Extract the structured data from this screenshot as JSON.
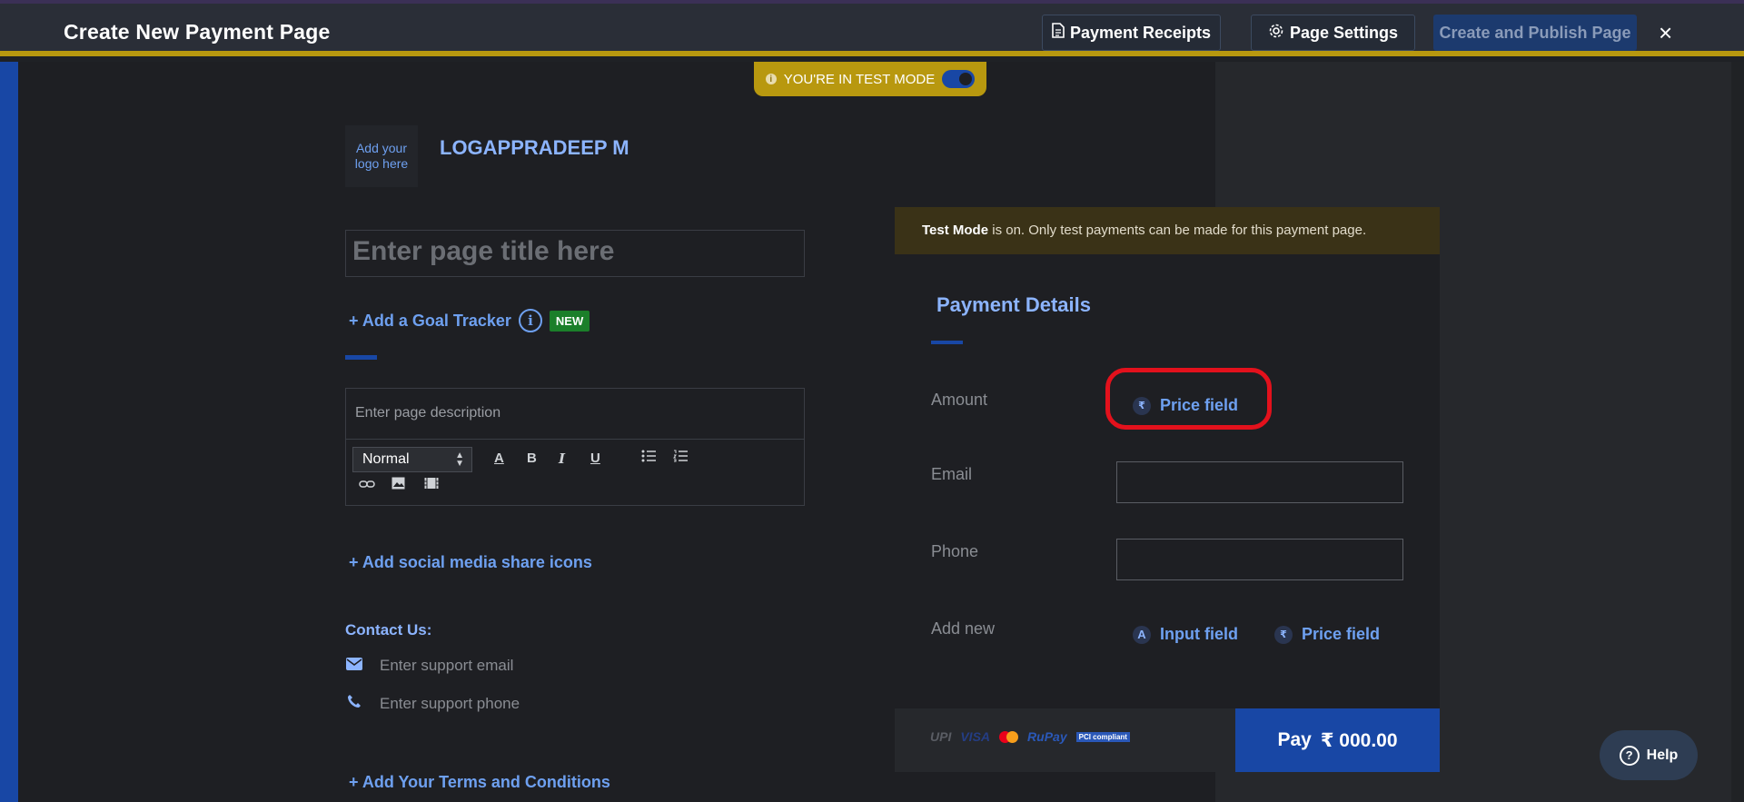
{
  "header": {
    "title": "Create New Payment Page",
    "receipts_label": "Payment Receipts",
    "settings_label": "Page Settings",
    "publish_label": "Create and Publish Page",
    "close_icon": "×"
  },
  "test_mode": {
    "label": "YOU'RE IN TEST MODE",
    "enabled": true
  },
  "page": {
    "logo_placeholder": "Add your logo here",
    "merchant_name": "LOGAPPRADEEP M",
    "title_placeholder": "Enter page title here",
    "goal_tracker_label": "+ Add a Goal Tracker",
    "new_badge": "NEW",
    "description_placeholder": "Enter page description",
    "editor_format": "Normal",
    "social_label": "+ Add social media share icons",
    "contact_heading": "Contact Us:",
    "support_email_placeholder": "Enter support email",
    "support_phone_placeholder": "Enter support phone",
    "terms_label": "+ Add Your Terms and Conditions"
  },
  "payment_card": {
    "banner_bold": "Test Mode",
    "banner_text": " is on. Only test payments can be made for this payment page.",
    "title": "Payment Details",
    "amount_label": "Amount",
    "price_field_label": "Price field",
    "email_label": "Email",
    "phone_label": "Phone",
    "add_new_label": "Add new",
    "add_input_label": "Input field",
    "add_price_label": "Price field",
    "pay_label": "Pay",
    "pay_amount": "₹ 000.00",
    "rupee_symbol": "₹",
    "logos": [
      "UPI",
      "VISA",
      "RuPay",
      "PCI compliant"
    ]
  },
  "help": {
    "label": "Help"
  },
  "colors": {
    "accent": "#1847a5",
    "gold": "#b8980f",
    "link": "#6ea0f0",
    "highlight": "#e3111c"
  }
}
